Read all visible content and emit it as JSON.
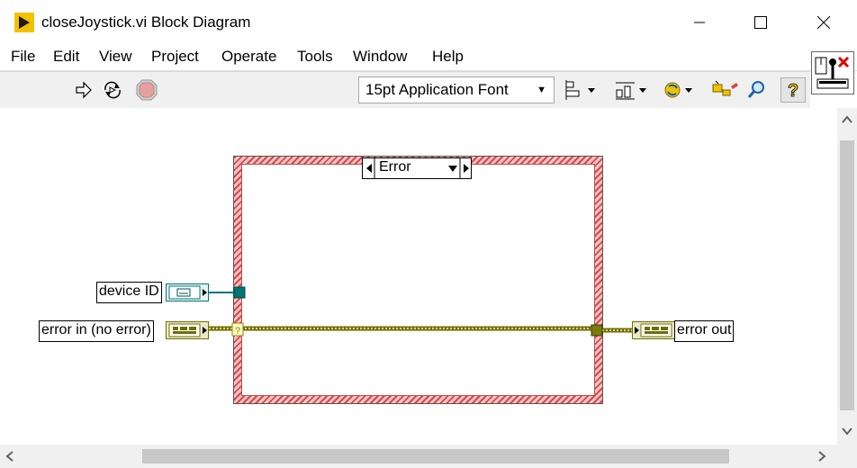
{
  "window": {
    "title": "closeJoystick.vi Block Diagram"
  },
  "menu": [
    "File",
    "Edit",
    "View",
    "Project",
    "Operate",
    "Tools",
    "Window",
    "Help"
  ],
  "toolbar": {
    "font_select": "15pt Application Font"
  },
  "diagram": {
    "case_selector_value": "Error",
    "inputs": {
      "device_id_label": "device ID",
      "error_in_label": "error in (no error)"
    },
    "outputs": {
      "error_out_label": "error out"
    },
    "selector_terminal_glyph": "?"
  },
  "colors": {
    "error_wire": "#8b8b00",
    "refnum_wire": "#007575",
    "case_border": "#d9474a"
  }
}
